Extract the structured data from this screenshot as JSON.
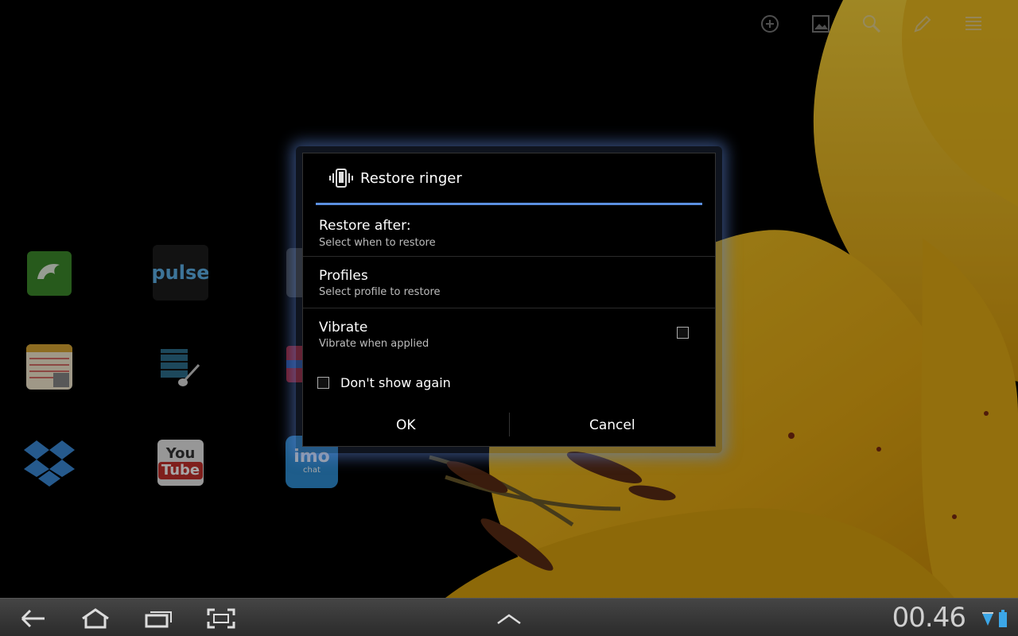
{
  "dialog": {
    "title": "Restore ringer",
    "icon": "vibrate-ringer-icon",
    "items": [
      {
        "title": "Restore after:",
        "summary": "Select when to restore"
      },
      {
        "title": "Profiles",
        "summary": "Select profile to restore"
      },
      {
        "title": "Vibrate",
        "summary": "Vibrate when applied",
        "checked": false
      }
    ],
    "dont_show_again": {
      "label": "Don't show again",
      "checked": false
    },
    "ok_label": "OK",
    "cancel_label": "Cancel"
  },
  "home_apps": [
    {
      "name": "dolphin-browser-app"
    },
    {
      "name": "pulse-app",
      "label": "pulse"
    },
    {
      "name": "notes-app"
    },
    {
      "name": "video-player-app"
    },
    {
      "name": "dropbox-app"
    },
    {
      "name": "youtube-app",
      "label_top": "You",
      "label_bottom": "Tube"
    },
    {
      "name": "imo-chat-app",
      "label": "imo",
      "sublabel": "chat"
    }
  ],
  "top_actions": [
    "add-icon",
    "wallpaper-icon",
    "search-icon",
    "edit-icon",
    "all-apps-icon"
  ],
  "system_bar": {
    "clock": "00.46",
    "nav": [
      "back-icon",
      "home-icon",
      "recent-apps-icon",
      "screenshot-icon"
    ],
    "notifications_arrow": "chevron-up-icon",
    "status": [
      "wifi-icon",
      "battery-icon"
    ]
  },
  "colors": {
    "accent": "#5b8fe0",
    "dialog_bg": "#000000",
    "petal": "#e8b51a"
  }
}
